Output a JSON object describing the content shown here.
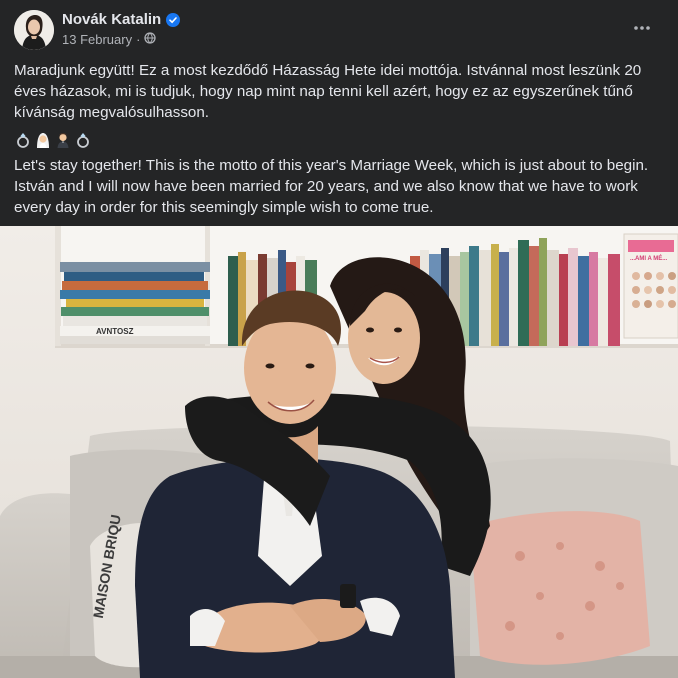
{
  "post": {
    "author": "Novák Katalin",
    "date": "13 February",
    "paragraphs": [
      "Maradjunk együtt! Ez a most kezdődő Házasság Hete idei mottója. Istvánnal most leszünk 20 éves házasok, mi is tudjuk, hogy nap mint nap tenni kell azért, hogy ez az egyszerűnek tűnő kívánság megvalósulhasson.",
      "Let's stay together! This is the motto of this year's Marriage Week, which is just about to begin. István and I will now have been married for 20 years, and we also know that we have to work every day in order for this seemingly simple wish to come true."
    ],
    "emojis": [
      "ring-icon",
      "bride-icon",
      "groom-icon",
      "ring-icon"
    ]
  },
  "icons": {
    "verified": "verified-badge-icon",
    "privacy": "globe-icon",
    "more": "more-options-icon"
  },
  "photo": {
    "book_spines": [
      "AVNTOSZ",
      "MAISON BRIQU"
    ],
    "book_cover": "...AMI A MÉ..."
  },
  "colors": {
    "background": "#242526",
    "text": "#e4e6eb",
    "secondary_text": "#b0b3b8",
    "verified": "#1877f2"
  }
}
